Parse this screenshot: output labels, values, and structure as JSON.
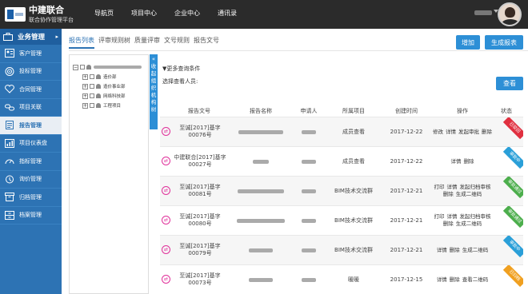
{
  "topbar": {
    "brand_title": "中建联合",
    "brand_subtitle": "联合协作管理平台",
    "nav": [
      "导航页",
      "项目中心",
      "企业中心",
      "通讯录"
    ]
  },
  "sidebar": {
    "header": "业务管理",
    "items": [
      {
        "label": "客户管理",
        "icon": "customer-icon"
      },
      {
        "label": "投标管理",
        "icon": "target-icon"
      },
      {
        "label": "合同管理",
        "icon": "handshake-icon"
      },
      {
        "label": "项目关联",
        "icon": "link-icon"
      },
      {
        "label": "报告管理",
        "icon": "report-icon",
        "active": true
      },
      {
        "label": "项目仪表盘",
        "icon": "dashboard-icon"
      },
      {
        "label": "指标管理",
        "icon": "gauge-icon"
      },
      {
        "label": "询价管理",
        "icon": "inquiry-icon"
      },
      {
        "label": "归档管理",
        "icon": "archive-icon"
      },
      {
        "label": "档案管理",
        "icon": "files-icon"
      }
    ]
  },
  "tabs": [
    "报告列表",
    "评审规则树",
    "质量评审",
    "文号规则",
    "报告文号"
  ],
  "actions": {
    "add": "增加",
    "generate": "生成报表"
  },
  "tree": {
    "nodes": [
      {
        "label": "造价部"
      },
      {
        "label": "造价事业部"
      },
      {
        "label": "网络科技部"
      },
      {
        "label": "工程项目"
      }
    ]
  },
  "collapse_handle": "收起组织机构树",
  "filter": {
    "title": "更多查询条件",
    "viewer_label": "选择查看人员:",
    "view_button": "查看"
  },
  "table": {
    "headers": [
      "报告文号",
      "报告名称",
      "申请人",
      "所属项目",
      "创建时间",
      "操作",
      "状态"
    ],
    "rows": [
      {
        "doc_no": "至诚[2017]基字00076号",
        "project": "成员查看",
        "date": "2017-12-22",
        "ops": [
          "修改",
          "详情",
          "发起审批",
          "删除"
        ],
        "status": "已驳回",
        "status_color": "#e03040"
      },
      {
        "doc_no": "中建联合[2017]基字00027号",
        "project": "成员查看",
        "date": "2017-12-22",
        "ops": [
          "详情",
          "删除"
        ],
        "status": "审批中",
        "status_color": "#2a9fd8"
      },
      {
        "doc_no": "至诚[2017]基字00081号",
        "project": "BIM技术交流群",
        "date": "2017-12-21",
        "ops": [
          "打印",
          "详情",
          "发起归档审核",
          "删除",
          "生成二维码"
        ],
        "status": "审批通过",
        "status_color": "#4cae4c"
      },
      {
        "doc_no": "至诚[2017]基字00080号",
        "project": "BIM技术交流群",
        "date": "2017-12-21",
        "ops": [
          "打印",
          "详情",
          "发起归档审核",
          "删除",
          "生成二维码"
        ],
        "status": "审批通过",
        "status_color": "#4cae4c"
      },
      {
        "doc_no": "至诚[2017]基字00079号",
        "project": "BIM技术交流群",
        "date": "2017-12-21",
        "ops": [
          "详情",
          "删除",
          "生成二维码"
        ],
        "status": "审批中",
        "status_color": "#2a9fd8"
      },
      {
        "doc_no": "至诚[2017]基字00073号",
        "project": "暖暖",
        "date": "2017-12-15",
        "ops": [
          "详情",
          "删除",
          "查看二维码"
        ],
        "status": "已归档",
        "status_color": "#f0a020"
      }
    ]
  }
}
